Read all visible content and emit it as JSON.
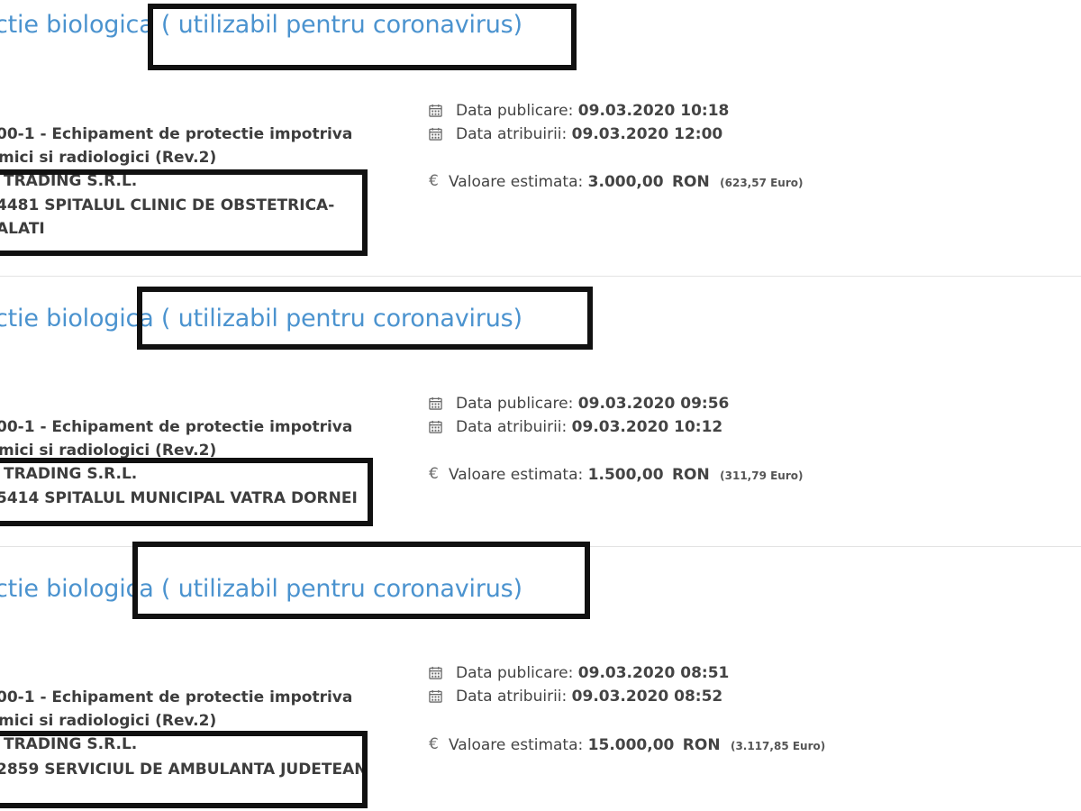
{
  "items": [
    {
      "title": "ctie biologica ( utilizabil pentru coronavirus)",
      "cpv_line1": "00-1 - Echipament de protectie impotriva",
      "cpv_line2": "mici si radiologici (Rev.2)",
      "supplier": "TRADING S.R.L.",
      "authority_line1": "4481 SPITALUL CLINIC DE OBSTETRICA-",
      "authority_line2": "ALATI",
      "pub_label": "Data publicare:",
      "pub_value": "09.03.2020 10:18",
      "award_label": "Data atribuirii:",
      "award_value": "09.03.2020 12:00",
      "value_label": "Valoare estimata:",
      "value_amount": "3.000,00",
      "value_currency": "RON",
      "value_eur": "(623,57  Euro)"
    },
    {
      "title": "ctie biologica ( utilizabil pentru coronavirus)",
      "cpv_line1": "00-1 - Echipament de protectie impotriva",
      "cpv_line2": "mici si radiologici (Rev.2)",
      "supplier": "TRADING S.R.L.",
      "authority_line1": "5414 SPITALUL MUNICIPAL VATRA DORNEI",
      "authority_line2": "",
      "pub_label": "Data publicare:",
      "pub_value": "09.03.2020 09:56",
      "award_label": "Data atribuirii:",
      "award_value": "09.03.2020 10:12",
      "value_label": "Valoare estimata:",
      "value_amount": "1.500,00",
      "value_currency": "RON",
      "value_eur": "(311,79  Euro)"
    },
    {
      "title": "ctie biologica ( utilizabil pentru coronavirus)",
      "cpv_line1": "00-1 - Echipament de protectie impotriva",
      "cpv_line2": "mici si radiologici (Rev.2)",
      "supplier": "TRADING S.R.L.",
      "authority_line1": "2859 SERVICIUL DE AMBULANTA JUDETEAN",
      "authority_line2": "",
      "pub_label": "Data publicare:",
      "pub_value": "09.03.2020 08:51",
      "award_label": "Data atribuirii:",
      "award_value": "09.03.2020 08:52",
      "value_label": "Valoare estimata:",
      "value_amount": "15.000,00",
      "value_currency": "RON",
      "value_eur": "(3.117,85  Euro)"
    }
  ],
  "icons": {
    "calendar": "calendar-icon",
    "euro": "€"
  }
}
